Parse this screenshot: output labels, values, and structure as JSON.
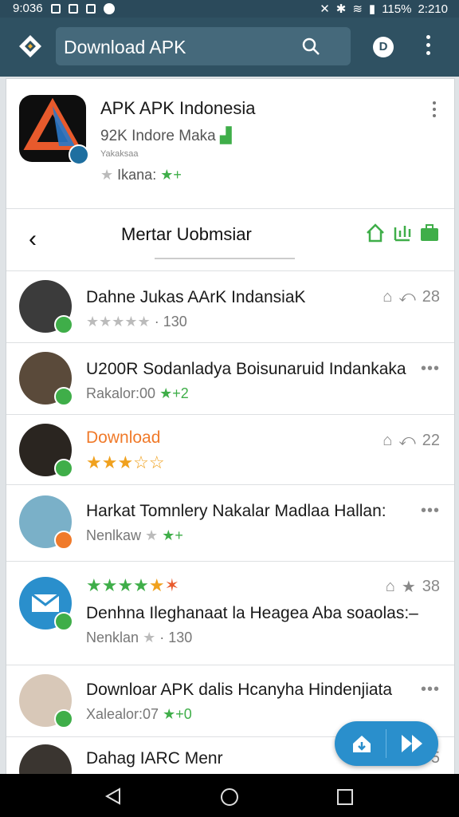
{
  "status": {
    "time_left": "9:036",
    "battery": "115%",
    "time": "2:210"
  },
  "search": {
    "placeholder": "Download APK"
  },
  "account": {
    "initial": "D"
  },
  "app": {
    "title": "APK APK Indonesia",
    "subtitle": "92K Indore Maka",
    "subtitle2": "Yakaksaa",
    "rating_label": "Ikana:"
  },
  "tab": {
    "title": "Mertar Uobmsiar"
  },
  "items": [
    {
      "title": "Dahne Jukas AArK IndansiaK",
      "meta": "· 130",
      "count": "28"
    },
    {
      "title": "U200R Sodanladya Boisunaruid Indankaka",
      "meta": "Rakalor:00"
    },
    {
      "title": "Download",
      "count": "22"
    },
    {
      "title": "Harkat Tomnlery Nakalar Madlaa Hallan:",
      "meta": "Nenlkaw"
    },
    {
      "title": "Denhna Ileghanaat la Heagea Aba soaolas:–",
      "meta": "Nenklan",
      "meta_count": "· 130",
      "count": "38"
    },
    {
      "title": "Downloar APK dalis Hcanyha Hindenjiata",
      "meta": "Xalealor:07"
    },
    {
      "title": "Dahag IARC Menr",
      "count": "5"
    }
  ],
  "colors": {
    "appbar": "#2f5162",
    "accent_green": "#3fae49",
    "accent_orange": "#f07a2a",
    "fab": "#2a8fcc"
  }
}
